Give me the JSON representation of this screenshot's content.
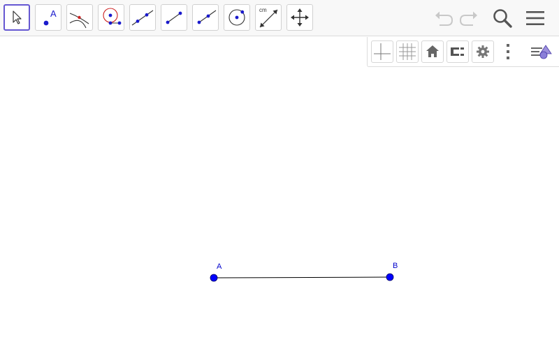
{
  "toolbar": {
    "tools": [
      {
        "name": "move-tool-icon",
        "selected": true
      },
      {
        "name": "point-tool-icon",
        "label": "A"
      },
      {
        "name": "intersect-tool-icon"
      },
      {
        "name": "point-on-object-tool-icon"
      },
      {
        "name": "line-tool-icon"
      },
      {
        "name": "segment-tool-icon"
      },
      {
        "name": "ray-tool-icon"
      },
      {
        "name": "circle-center-point-tool-icon"
      },
      {
        "name": "distance-tool-icon",
        "label": "cm"
      },
      {
        "name": "move-graphics-view-tool-icon"
      }
    ],
    "undo_icon": "undo-icon",
    "redo_icon": "redo-icon",
    "search_icon": "search-icon",
    "menu_icon": "menu-icon"
  },
  "stylebar": {
    "buttons": [
      "axes-toggle-icon",
      "grid-toggle-icon",
      "home-icon",
      "point-capturing-icon",
      "settings-gear-icon",
      "more-options-icon",
      "algebra-view-toggle-icon"
    ]
  },
  "construction": {
    "point_a_label": "A",
    "point_b_label": "B",
    "point_color": "#0000ff",
    "segment_color": "#000000"
  },
  "colors": {
    "accent": "#6557d2",
    "toolbar_bg": "#f8f8f8",
    "point_blue": "#0000ff"
  }
}
